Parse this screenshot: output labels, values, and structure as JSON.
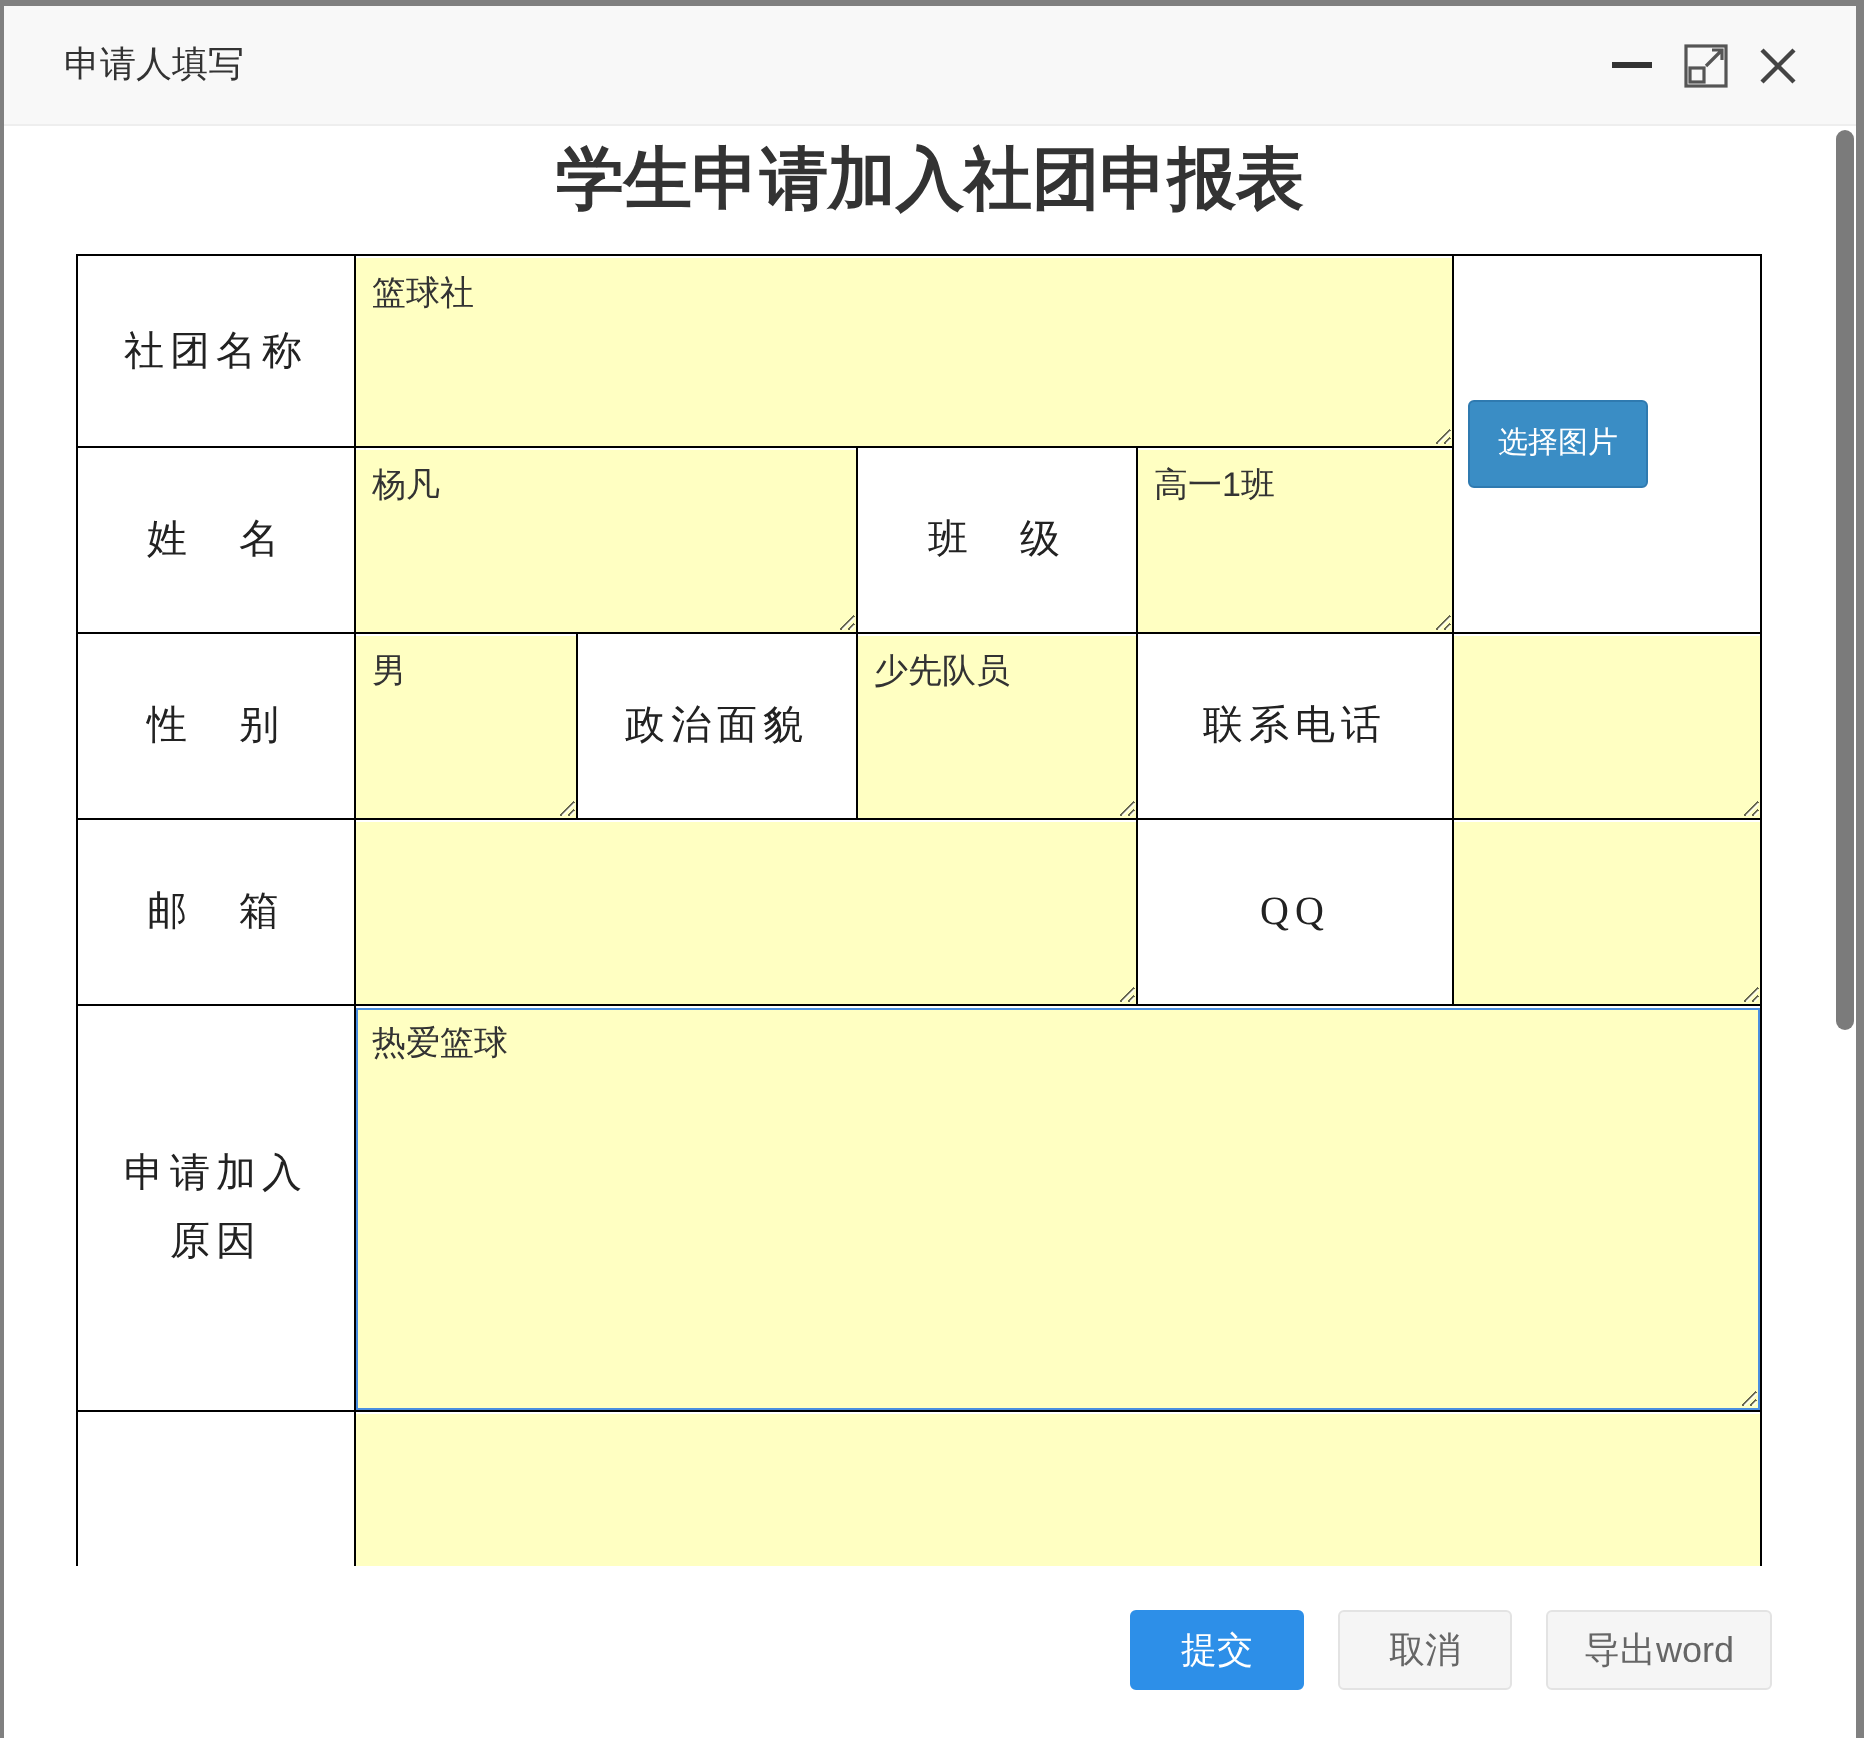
{
  "dialog": {
    "title": "申请人填写",
    "heading": "学生申请加入社团申报表"
  },
  "rows": [
    [
      {
        "kind": "label",
        "text": "社团名称"
      },
      {
        "kind": "field",
        "value": "篮球社",
        "focused": false
      },
      {
        "kind": "photo",
        "button": "选择图片"
      }
    ],
    [
      {
        "kind": "label",
        "text": "姓　名"
      },
      {
        "kind": "field",
        "value": "杨凡",
        "focused": false
      },
      {
        "kind": "label",
        "text": "班　级"
      },
      {
        "kind": "field",
        "value": "高一1班",
        "focused": false
      }
    ],
    [
      {
        "kind": "label",
        "text": "性　别"
      },
      {
        "kind": "field",
        "value": "男",
        "focused": false
      },
      {
        "kind": "label",
        "text": "政治面貌"
      },
      {
        "kind": "field",
        "value": "少先队员",
        "focused": false
      },
      {
        "kind": "label",
        "text": "联系电话"
      },
      {
        "kind": "field",
        "focused": false
      }
    ],
    [
      {
        "kind": "label",
        "text": "邮　箱"
      },
      {
        "kind": "field",
        "focused": false
      },
      {
        "kind": "label",
        "text": "QQ"
      },
      {
        "kind": "field",
        "focused": false
      }
    ],
    [
      {
        "kind": "label",
        "text": "申请加入原因"
      },
      {
        "kind": "field",
        "value": "热爱篮球",
        "focused": true
      }
    ],
    [
      {
        "kind": "label"
      },
      {
        "kind": "field",
        "focused": false
      }
    ]
  ],
  "buttons": [
    {
      "label": "提交",
      "kind": "primary"
    },
    {
      "label": "取消",
      "kind": "default"
    },
    {
      "label": "导出word",
      "kind": "default"
    }
  ]
}
